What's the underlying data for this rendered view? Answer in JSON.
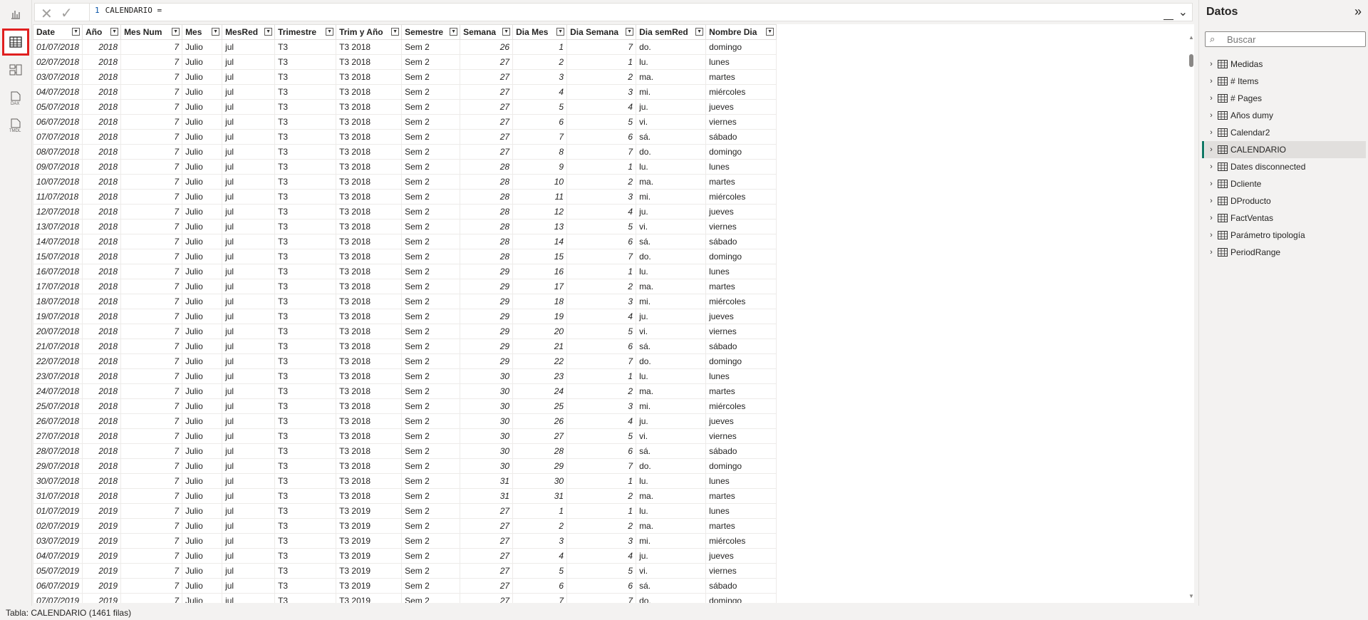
{
  "formula": {
    "line": "1",
    "text": "CALENDARIO ="
  },
  "columns": [
    {
      "label": "Date",
      "w": 56
    },
    {
      "label": "Año",
      "w": 54
    },
    {
      "label": "Mes Num",
      "w": 86
    },
    {
      "label": "Mes",
      "w": 56
    },
    {
      "label": "MesRed",
      "w": 74
    },
    {
      "label": "Trimestre",
      "w": 86
    },
    {
      "label": "Trim y Año",
      "w": 92
    },
    {
      "label": "Semestre",
      "w": 82
    },
    {
      "label": "Semana",
      "w": 74
    },
    {
      "label": "Dia Mes",
      "w": 76
    },
    {
      "label": "Dia Semana",
      "w": 97
    },
    {
      "label": "Dia semRed",
      "w": 98
    },
    {
      "label": "Nombre Dia",
      "w": 99
    }
  ],
  "rows": [
    [
      "01/07/2018",
      "2018",
      "7",
      "Julio",
      "jul",
      "T3",
      "T3 2018",
      "Sem 2",
      "26",
      "1",
      "7",
      "do.",
      "domingo"
    ],
    [
      "02/07/2018",
      "2018",
      "7",
      "Julio",
      "jul",
      "T3",
      "T3 2018",
      "Sem 2",
      "27",
      "2",
      "1",
      "lu.",
      "lunes"
    ],
    [
      "03/07/2018",
      "2018",
      "7",
      "Julio",
      "jul",
      "T3",
      "T3 2018",
      "Sem 2",
      "27",
      "3",
      "2",
      "ma.",
      "martes"
    ],
    [
      "04/07/2018",
      "2018",
      "7",
      "Julio",
      "jul",
      "T3",
      "T3 2018",
      "Sem 2",
      "27",
      "4",
      "3",
      "mi.",
      "miércoles"
    ],
    [
      "05/07/2018",
      "2018",
      "7",
      "Julio",
      "jul",
      "T3",
      "T3 2018",
      "Sem 2",
      "27",
      "5",
      "4",
      "ju.",
      "jueves"
    ],
    [
      "06/07/2018",
      "2018",
      "7",
      "Julio",
      "jul",
      "T3",
      "T3 2018",
      "Sem 2",
      "27",
      "6",
      "5",
      "vi.",
      "viernes"
    ],
    [
      "07/07/2018",
      "2018",
      "7",
      "Julio",
      "jul",
      "T3",
      "T3 2018",
      "Sem 2",
      "27",
      "7",
      "6",
      "sá.",
      "sábado"
    ],
    [
      "08/07/2018",
      "2018",
      "7",
      "Julio",
      "jul",
      "T3",
      "T3 2018",
      "Sem 2",
      "27",
      "8",
      "7",
      "do.",
      "domingo"
    ],
    [
      "09/07/2018",
      "2018",
      "7",
      "Julio",
      "jul",
      "T3",
      "T3 2018",
      "Sem 2",
      "28",
      "9",
      "1",
      "lu.",
      "lunes"
    ],
    [
      "10/07/2018",
      "2018",
      "7",
      "Julio",
      "jul",
      "T3",
      "T3 2018",
      "Sem 2",
      "28",
      "10",
      "2",
      "ma.",
      "martes"
    ],
    [
      "11/07/2018",
      "2018",
      "7",
      "Julio",
      "jul",
      "T3",
      "T3 2018",
      "Sem 2",
      "28",
      "11",
      "3",
      "mi.",
      "miércoles"
    ],
    [
      "12/07/2018",
      "2018",
      "7",
      "Julio",
      "jul",
      "T3",
      "T3 2018",
      "Sem 2",
      "28",
      "12",
      "4",
      "ju.",
      "jueves"
    ],
    [
      "13/07/2018",
      "2018",
      "7",
      "Julio",
      "jul",
      "T3",
      "T3 2018",
      "Sem 2",
      "28",
      "13",
      "5",
      "vi.",
      "viernes"
    ],
    [
      "14/07/2018",
      "2018",
      "7",
      "Julio",
      "jul",
      "T3",
      "T3 2018",
      "Sem 2",
      "28",
      "14",
      "6",
      "sá.",
      "sábado"
    ],
    [
      "15/07/2018",
      "2018",
      "7",
      "Julio",
      "jul",
      "T3",
      "T3 2018",
      "Sem 2",
      "28",
      "15",
      "7",
      "do.",
      "domingo"
    ],
    [
      "16/07/2018",
      "2018",
      "7",
      "Julio",
      "jul",
      "T3",
      "T3 2018",
      "Sem 2",
      "29",
      "16",
      "1",
      "lu.",
      "lunes"
    ],
    [
      "17/07/2018",
      "2018",
      "7",
      "Julio",
      "jul",
      "T3",
      "T3 2018",
      "Sem 2",
      "29",
      "17",
      "2",
      "ma.",
      "martes"
    ],
    [
      "18/07/2018",
      "2018",
      "7",
      "Julio",
      "jul",
      "T3",
      "T3 2018",
      "Sem 2",
      "29",
      "18",
      "3",
      "mi.",
      "miércoles"
    ],
    [
      "19/07/2018",
      "2018",
      "7",
      "Julio",
      "jul",
      "T3",
      "T3 2018",
      "Sem 2",
      "29",
      "19",
      "4",
      "ju.",
      "jueves"
    ],
    [
      "20/07/2018",
      "2018",
      "7",
      "Julio",
      "jul",
      "T3",
      "T3 2018",
      "Sem 2",
      "29",
      "20",
      "5",
      "vi.",
      "viernes"
    ],
    [
      "21/07/2018",
      "2018",
      "7",
      "Julio",
      "jul",
      "T3",
      "T3 2018",
      "Sem 2",
      "29",
      "21",
      "6",
      "sá.",
      "sábado"
    ],
    [
      "22/07/2018",
      "2018",
      "7",
      "Julio",
      "jul",
      "T3",
      "T3 2018",
      "Sem 2",
      "29",
      "22",
      "7",
      "do.",
      "domingo"
    ],
    [
      "23/07/2018",
      "2018",
      "7",
      "Julio",
      "jul",
      "T3",
      "T3 2018",
      "Sem 2",
      "30",
      "23",
      "1",
      "lu.",
      "lunes"
    ],
    [
      "24/07/2018",
      "2018",
      "7",
      "Julio",
      "jul",
      "T3",
      "T3 2018",
      "Sem 2",
      "30",
      "24",
      "2",
      "ma.",
      "martes"
    ],
    [
      "25/07/2018",
      "2018",
      "7",
      "Julio",
      "jul",
      "T3",
      "T3 2018",
      "Sem 2",
      "30",
      "25",
      "3",
      "mi.",
      "miércoles"
    ],
    [
      "26/07/2018",
      "2018",
      "7",
      "Julio",
      "jul",
      "T3",
      "T3 2018",
      "Sem 2",
      "30",
      "26",
      "4",
      "ju.",
      "jueves"
    ],
    [
      "27/07/2018",
      "2018",
      "7",
      "Julio",
      "jul",
      "T3",
      "T3 2018",
      "Sem 2",
      "30",
      "27",
      "5",
      "vi.",
      "viernes"
    ],
    [
      "28/07/2018",
      "2018",
      "7",
      "Julio",
      "jul",
      "T3",
      "T3 2018",
      "Sem 2",
      "30",
      "28",
      "6",
      "sá.",
      "sábado"
    ],
    [
      "29/07/2018",
      "2018",
      "7",
      "Julio",
      "jul",
      "T3",
      "T3 2018",
      "Sem 2",
      "30",
      "29",
      "7",
      "do.",
      "domingo"
    ],
    [
      "30/07/2018",
      "2018",
      "7",
      "Julio",
      "jul",
      "T3",
      "T3 2018",
      "Sem 2",
      "31",
      "30",
      "1",
      "lu.",
      "lunes"
    ],
    [
      "31/07/2018",
      "2018",
      "7",
      "Julio",
      "jul",
      "T3",
      "T3 2018",
      "Sem 2",
      "31",
      "31",
      "2",
      "ma.",
      "martes"
    ],
    [
      "01/07/2019",
      "2019",
      "7",
      "Julio",
      "jul",
      "T3",
      "T3 2019",
      "Sem 2",
      "27",
      "1",
      "1",
      "lu.",
      "lunes"
    ],
    [
      "02/07/2019",
      "2019",
      "7",
      "Julio",
      "jul",
      "T3",
      "T3 2019",
      "Sem 2",
      "27",
      "2",
      "2",
      "ma.",
      "martes"
    ],
    [
      "03/07/2019",
      "2019",
      "7",
      "Julio",
      "jul",
      "T3",
      "T3 2019",
      "Sem 2",
      "27",
      "3",
      "3",
      "mi.",
      "miércoles"
    ],
    [
      "04/07/2019",
      "2019",
      "7",
      "Julio",
      "jul",
      "T3",
      "T3 2019",
      "Sem 2",
      "27",
      "4",
      "4",
      "ju.",
      "jueves"
    ],
    [
      "05/07/2019",
      "2019",
      "7",
      "Julio",
      "jul",
      "T3",
      "T3 2019",
      "Sem 2",
      "27",
      "5",
      "5",
      "vi.",
      "viernes"
    ],
    [
      "06/07/2019",
      "2019",
      "7",
      "Julio",
      "jul",
      "T3",
      "T3 2019",
      "Sem 2",
      "27",
      "6",
      "6",
      "sá.",
      "sábado"
    ],
    [
      "07/07/2019",
      "2019",
      "7",
      "Julio",
      "jul",
      "T3",
      "T3 2019",
      "Sem 2",
      "27",
      "7",
      "7",
      "do.",
      "domingo"
    ]
  ],
  "numeric_columns": [
    1,
    2,
    8,
    9,
    10
  ],
  "pane": {
    "title": "Datos",
    "search_placeholder": "Buscar",
    "items": [
      {
        "label": "Medidas",
        "icon": "measures-table-icon",
        "selected": false
      },
      {
        "label": "# Items",
        "icon": "calc-table-icon",
        "selected": false
      },
      {
        "label": "# Pages",
        "icon": "calc-table-icon",
        "selected": false
      },
      {
        "label": "Años dumy",
        "icon": "table-icon",
        "selected": false
      },
      {
        "label": "Calendar2",
        "icon": "calc-table-icon",
        "selected": false
      },
      {
        "label": "CALENDARIO",
        "icon": "calc-table-icon",
        "selected": true
      },
      {
        "label": "Dates disconnected",
        "icon": "calc-table-icon",
        "selected": false
      },
      {
        "label": "Dcliente",
        "icon": "table-icon",
        "selected": false
      },
      {
        "label": "DProducto",
        "icon": "table-icon",
        "selected": false
      },
      {
        "label": "FactVentas",
        "icon": "table-icon",
        "selected": false
      },
      {
        "label": "Parámetro tipología",
        "icon": "calc-table-icon",
        "selected": false
      },
      {
        "label": "PeriodRange",
        "icon": "calc-table-icon",
        "selected": false
      }
    ]
  },
  "status": "Tabla: CALENDARIO (1461 filas)",
  "colors": {
    "accent": "#117865",
    "highlight": "#e02020"
  }
}
